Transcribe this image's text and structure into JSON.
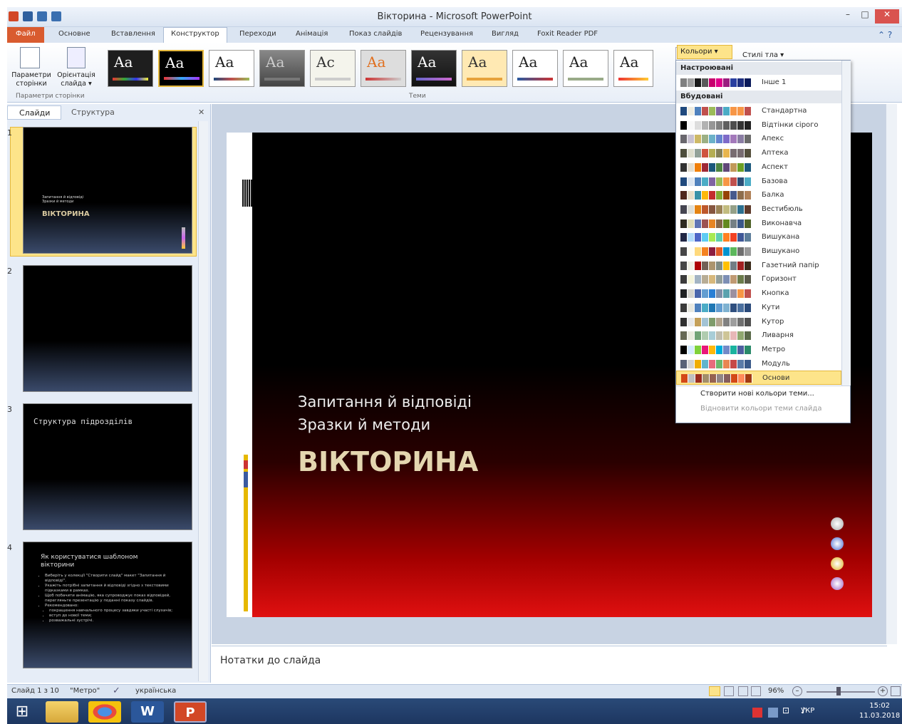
{
  "window": {
    "title": "Вікторина - Microsoft PowerPoint"
  },
  "tabs": [
    "Файл",
    "Основне",
    "Вставлення",
    "Конструктор",
    "Переходи",
    "Анімація",
    "Показ слайдів",
    "Рецензування",
    "Вигляд",
    "Foxit Reader PDF"
  ],
  "ribbon": {
    "page_setup": "Параметри сторінки",
    "orientation": "Орієнтація слайда",
    "orientation_arrow": "▾",
    "group_page": "Параметри сторінки",
    "group_themes": "Теми",
    "colors_btn": "Кольори ▾",
    "bg_styles": "Стилі тла ▾",
    "theme_sample": "Aa",
    "theme_sample_alt": "Ac"
  },
  "left_panel": {
    "tab_slides": "Слайди",
    "tab_outline": "Структура",
    "close": "✕",
    "slides": [
      {
        "num": "1",
        "line1": "Запитання й відповіді",
        "line2": "Зразки й методи",
        "title": "ВІКТОРИНА"
      },
      {
        "num": "2"
      },
      {
        "num": "3",
        "title": "Структура підрозділів"
      },
      {
        "num": "4",
        "title": "Як користуватися шаблоном вікторини",
        "bullets": [
          "Виберіть у колекції \"Створити слайд\" макет \"Запитання й відповіді\".",
          "Укажіть потрібні запитання й відповіді згідно з текстовими підказками в рамках.",
          "Щоб побачити анімацію, яка супроводжує показ відповідей, перегляньте презентацію у поданні показу слайдів.",
          "Рекомендовано:",
          "покращення навчального процесу завдяки участі слухачів;",
          "вступ до нової теми;",
          "розважальні зустрічі."
        ]
      }
    ]
  },
  "slide": {
    "line1": "Запитання й відповіді",
    "line2": "Зразки й методи",
    "title": "ВІКТОРИНА"
  },
  "notes": {
    "placeholder": "Нотатки до слайда"
  },
  "dropdown": {
    "custom_header": "Настроювані",
    "custom_items": [
      {
        "name": "Інше 1",
        "colors": [
          "#808080",
          "#a0a0a0",
          "#1a1a1a",
          "#5a5a5a",
          "#c8006e",
          "#e0008a",
          "#9b1e7f",
          "#2a3fa0",
          "#1e2f80",
          "#0a1a5a"
        ]
      }
    ],
    "builtin_header": "Вбудовані",
    "builtin_items": [
      {
        "name": "Стандартна",
        "colors": [
          "#1f497d",
          "#eeece1",
          "#4f81bd",
          "#c0504d",
          "#9bbb59",
          "#8064a2",
          "#4bacc6",
          "#f79646",
          "#f79646",
          "#c0504d"
        ]
      },
      {
        "name": "Відтінки сірого",
        "colors": [
          "#000000",
          "#f8f8f8",
          "#dddddd",
          "#b2b2b2",
          "#969696",
          "#808080",
          "#5f5f5f",
          "#4d4d4d",
          "#333333",
          "#222222"
        ]
      },
      {
        "name": "Апекс",
        "colors": [
          "#69676d",
          "#c9c2d1",
          "#ceb966",
          "#9cb084",
          "#6bb1c9",
          "#6585cf",
          "#7e6bc9",
          "#a379bb",
          "#8a7da3",
          "#6b6b6b"
        ]
      },
      {
        "name": "Аптека",
        "colors": [
          "#4e4e3c",
          "#dedece",
          "#93a299",
          "#cf543f",
          "#b5ae53",
          "#848058",
          "#e8b54d",
          "#786c71",
          "#786c71",
          "#544f3c"
        ]
      },
      {
        "name": "Аспект",
        "colors": [
          "#323232",
          "#e3ded1",
          "#f07f09",
          "#9f2936",
          "#1b587c",
          "#4e8542",
          "#604878",
          "#c19859",
          "#6b9f25",
          "#1b587c"
        ]
      },
      {
        "name": "Базова",
        "colors": [
          "#1f497d",
          "#dbe5f1",
          "#4f81bd",
          "#4bacc6",
          "#8064a2",
          "#9bbb59",
          "#f79646",
          "#c0504d",
          "#2c4d75",
          "#4bacc6"
        ]
      },
      {
        "name": "Балка",
        "colors": [
          "#4f271c",
          "#e7dec9",
          "#3891a7",
          "#feb80a",
          "#c32d2e",
          "#84aa33",
          "#964305",
          "#475a8d",
          "#8d6d4c",
          "#b08158"
        ]
      },
      {
        "name": "Вестибюль",
        "colors": [
          "#454551",
          "#dedfd8",
          "#e48312",
          "#bd582c",
          "#865640",
          "#9b8357",
          "#c2bc80",
          "#94a088",
          "#2c6f8f",
          "#5e3a2b"
        ]
      },
      {
        "name": "Виконавча",
        "colors": [
          "#2f2b20",
          "#dfdcb7",
          "#6076b4",
          "#9c5252",
          "#e68422",
          "#846648",
          "#63891f",
          "#758085",
          "#3b5888",
          "#4f6228"
        ]
      },
      {
        "name": "Вишукана",
        "colors": [
          "#212745",
          "#b4dcfa",
          "#4e67c8",
          "#5eccf3",
          "#a7ea52",
          "#5dceaf",
          "#ff8021",
          "#f14124",
          "#3e5797",
          "#5c7d9a"
        ]
      },
      {
        "name": "Вишукано",
        "colors": [
          "#464646",
          "#fffdf3",
          "#ffd97a",
          "#f58220",
          "#8c1d40",
          "#e25d28",
          "#0093d0",
          "#5cb85c",
          "#6f6f6f",
          "#999999"
        ]
      },
      {
        "name": "Газетний папір",
        "colors": [
          "#464646",
          "#eeeee2",
          "#ad0101",
          "#726056",
          "#ac956e",
          "#808c83",
          "#ffc000",
          "#727d85",
          "#a12020",
          "#3a2a1a"
        ]
      },
      {
        "name": "Горизонт",
        "colors": [
          "#3b3b3b",
          "#f5f5dc",
          "#a3b4c3",
          "#b8ad95",
          "#d7b87c",
          "#939f9b",
          "#7d8fb5",
          "#c09a73",
          "#6b7b4b",
          "#5a5a4a"
        ]
      },
      {
        "name": "Кнопка",
        "colors": [
          "#1f2123",
          "#d5d5cf",
          "#4a66ac",
          "#629dd1",
          "#297fd5",
          "#7f8fa9",
          "#5aa2ae",
          "#9d90a0",
          "#f79646",
          "#c0504d"
        ]
      },
      {
        "name": "Кути",
        "colors": [
          "#3b3b3b",
          "#e8e8e0",
          "#4f81bd",
          "#4bacc6",
          "#1f77b4",
          "#629dd1",
          "#7fb2d1",
          "#2f4f7f",
          "#4a6f9f",
          "#2a4a7a"
        ]
      },
      {
        "name": "Кутор",
        "colors": [
          "#303030",
          "#e8e8e8",
          "#c5a059",
          "#a2c3d4",
          "#7f9c6b",
          "#b2a48e",
          "#818181",
          "#9d9d9d",
          "#6f6f6f",
          "#505050"
        ]
      },
      {
        "name": "Ливарня",
        "colors": [
          "#676a55",
          "#eaebde",
          "#72a376",
          "#b0ccb0",
          "#a8cdd7",
          "#c0beaf",
          "#cec597",
          "#e8b7b7",
          "#8fa76f",
          "#5a6a4a"
        ]
      },
      {
        "name": "Метро",
        "colors": [
          "#000000",
          "#d6ecff",
          "#7fd13b",
          "#ea157a",
          "#feb80a",
          "#00addc",
          "#738ac8",
          "#1ab39f",
          "#4d5fa0",
          "#2a8a6a"
        ]
      },
      {
        "name": "Модуль",
        "colors": [
          "#5a6378",
          "#d4d4d4",
          "#f0ad00",
          "#60b5cc",
          "#e66c7d",
          "#6bb76d",
          "#e88651",
          "#c64847",
          "#5a7ba8",
          "#3a5a8a"
        ]
      },
      {
        "name": "Основи",
        "colors": [
          "#d34817",
          "#c0c0c0",
          "#9b2d1f",
          "#a28e6a",
          "#956251",
          "#918485",
          "#855d5d",
          "#d34817",
          "#ff8a5a",
          "#a33a12"
        ]
      }
    ],
    "cmd_new": "Створити нові кольори теми...",
    "cmd_reset": "Відновити кольори теми слайда"
  },
  "status": {
    "slide": "Слайд 1 з 10",
    "theme": "\"Метро\"",
    "lang": "українська",
    "zoom": "96%"
  },
  "tray": {
    "lang": "УКР",
    "time": "15:02",
    "date": "11.03.2018"
  }
}
